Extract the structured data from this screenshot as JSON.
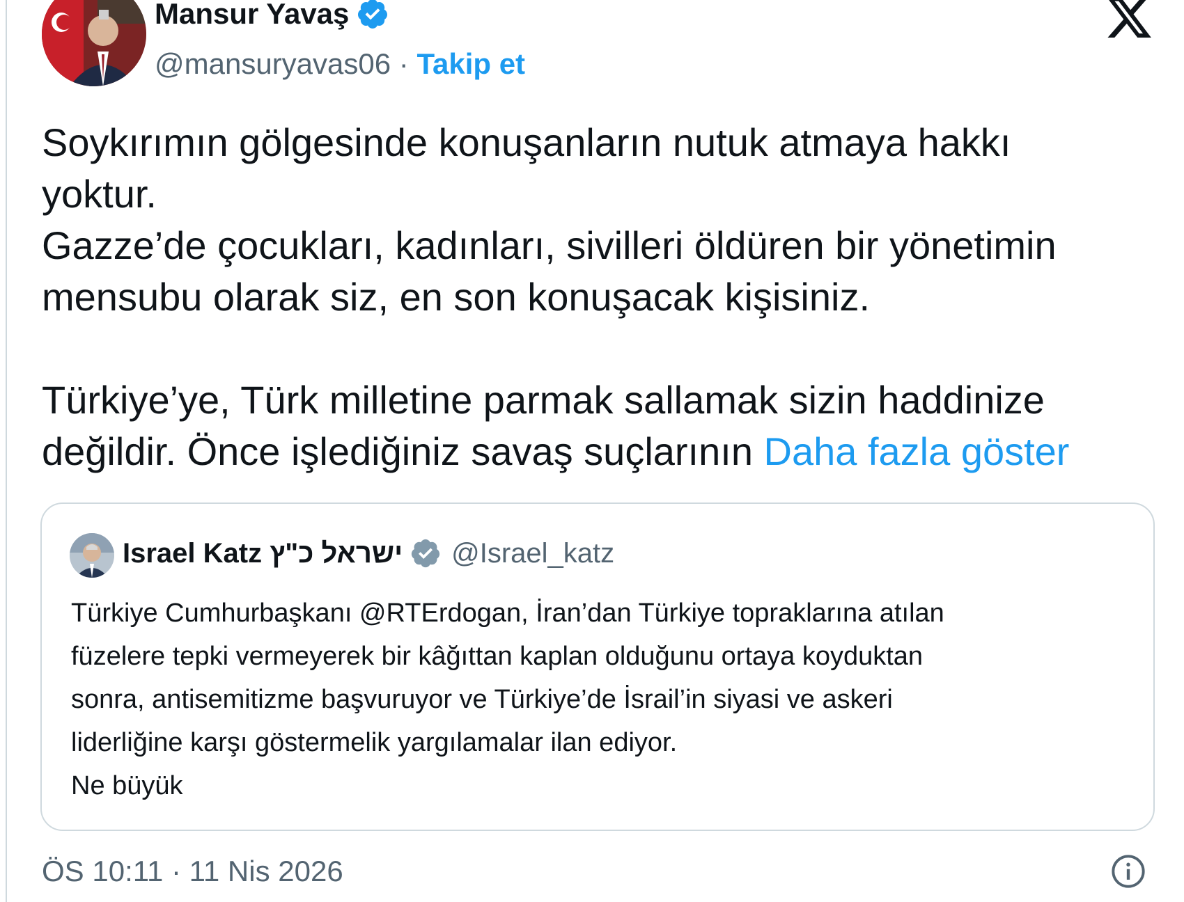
{
  "author": {
    "name": "Mansur Yavaş",
    "handle": "@mansuryavas06",
    "separator": " · ",
    "follow_label": "Takip et"
  },
  "icons": {
    "avatar": "avatar-portrait",
    "verified": "verified-badge-icon",
    "logo": "x-logo-icon",
    "info": "info-icon"
  },
  "tweet": {
    "text": "Soykırımın gölgesinde konuşanların nutuk atmaya hakkı\nyoktur.\nGazze’de çocukları, kadınları, sivilleri öldüren bir yönetimin\nmensubu olarak siz, en son konuşacak kişisiniz.\n\nTürkiye’ye, Türk milletine parmak sallamak sizin haddinize\ndeğildir. Önce işlediğiniz savaş suçlarının ",
    "show_more_label": "Daha fazla göster"
  },
  "quoted_tweet": {
    "name": "Israel Katz ישראל כ\"ץ",
    "handle": "@Israel_katz",
    "text": "Türkiye Cumhurbaşkanı @RTErdogan, İran’dan Türkiye topraklarına atılan\nfüzelere tepki vermeyerek bir kâğıttan kaplan olduğunu ortaya koyduktan\nsonra, antisemitizme başvuruyor ve Türkiye’de İsrail’in siyasi ve askeri\nliderliğine karşı göstermelik yargılamalar ilan ediyor.\nNe büyük"
  },
  "timestamp": "ÖS 10:11 · 11 Nis 2026",
  "colors": {
    "accent": "#1d9bf0",
    "text_primary": "#0f1419",
    "text_secondary": "#536471",
    "border": "#cfd9de"
  }
}
